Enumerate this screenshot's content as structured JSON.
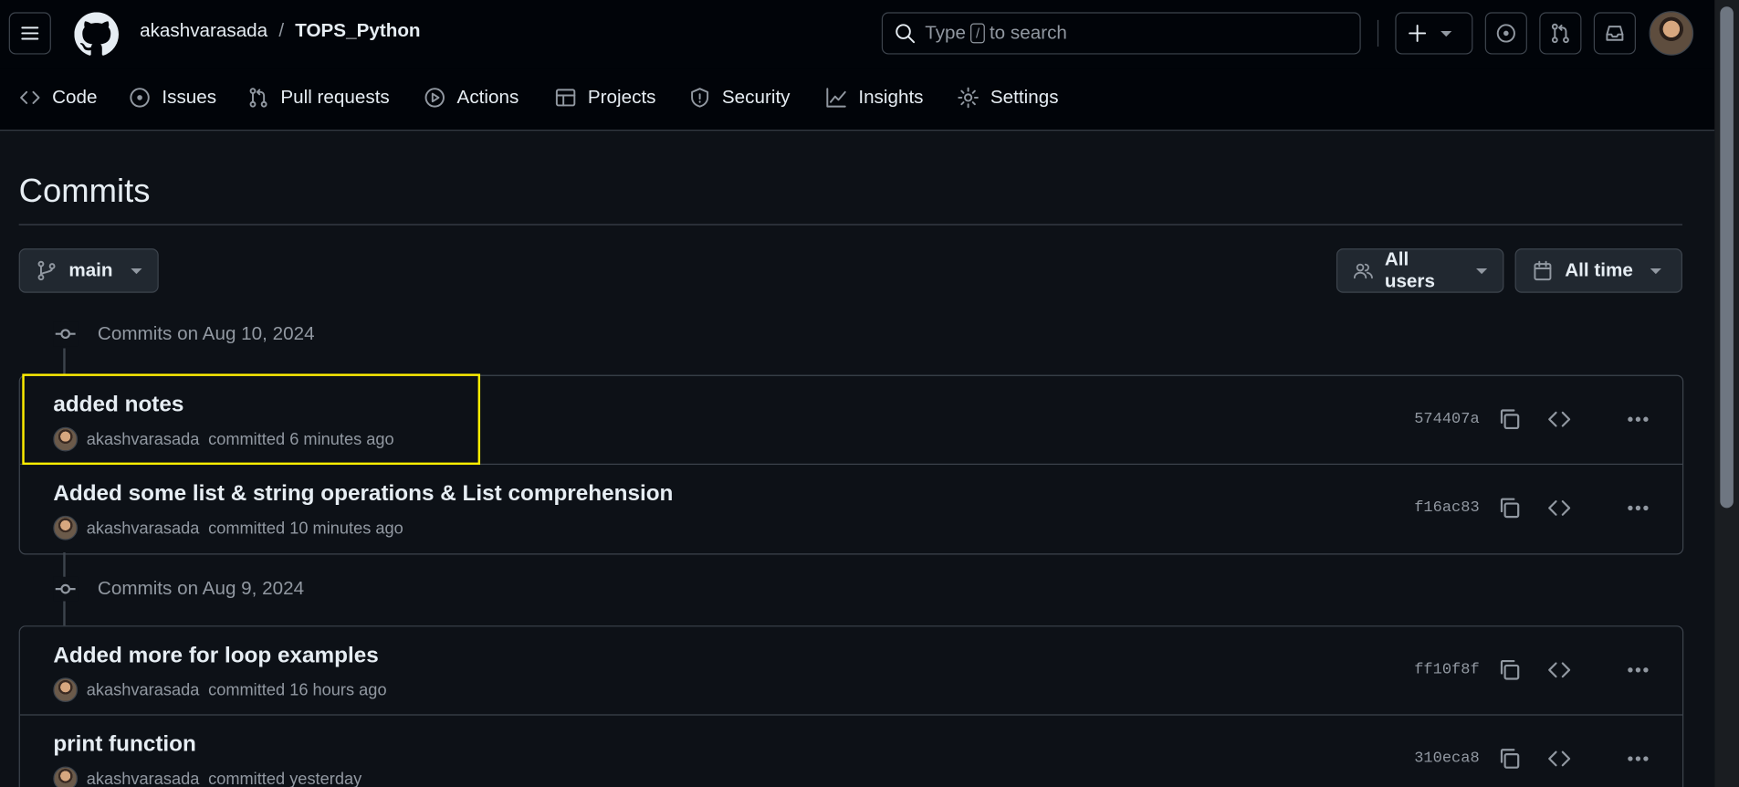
{
  "header": {
    "owner": "akashvarasada",
    "separator": "/",
    "repo": "TOPS_Python",
    "search": {
      "prefix": "Type",
      "key": "/",
      "suffix": "to search"
    }
  },
  "nav": {
    "tabs": [
      {
        "label": "Code",
        "icon": "code-icon"
      },
      {
        "label": "Issues",
        "icon": "issue-icon"
      },
      {
        "label": "Pull requests",
        "icon": "pull-request-icon"
      },
      {
        "label": "Actions",
        "icon": "play-icon"
      },
      {
        "label": "Projects",
        "icon": "table-icon"
      },
      {
        "label": "Security",
        "icon": "shield-icon"
      },
      {
        "label": "Insights",
        "icon": "graph-icon"
      },
      {
        "label": "Settings",
        "icon": "gear-icon"
      }
    ]
  },
  "page": {
    "title": "Commits",
    "branch": "main",
    "users_filter": "All users",
    "time_filter": "All time"
  },
  "groups": [
    {
      "heading": "Commits on Aug 10, 2024",
      "commits": [
        {
          "title": "added notes",
          "author": "akashvarasada",
          "when": "committed 6 minutes ago",
          "sha": "574407a"
        },
        {
          "title": "Added some list & string operations & List comprehension",
          "author": "akashvarasada",
          "when": "committed 10 minutes ago",
          "sha": "f16ac83"
        }
      ]
    },
    {
      "heading": "Commits on Aug 9, 2024",
      "commits": [
        {
          "title": "Added more for loop examples",
          "author": "akashvarasada",
          "when": "committed 16 hours ago",
          "sha": "ff10f8f"
        },
        {
          "title": "print function",
          "author": "akashvarasada",
          "when": "committed yesterday",
          "sha": "310eca8"
        }
      ]
    }
  ],
  "colors": {
    "background": "#0d1117",
    "header_bg": "#010409",
    "border": "#3d444d",
    "muted_text": "#9198a1",
    "highlight": "#ffee00"
  }
}
